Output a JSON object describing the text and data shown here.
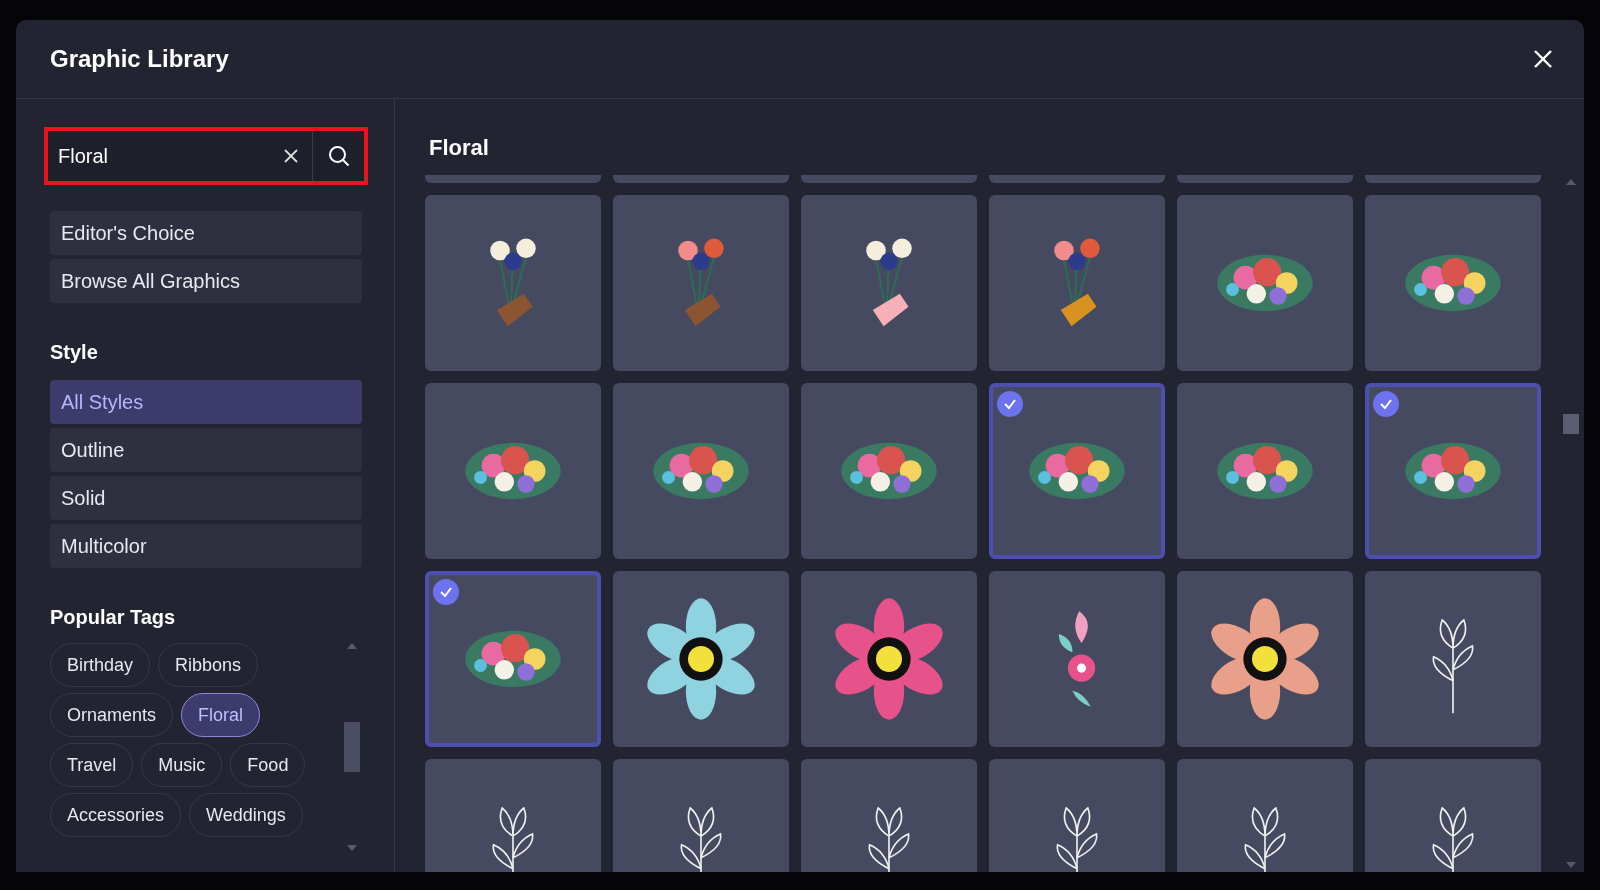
{
  "window": {
    "title": "Graphic Library"
  },
  "search": {
    "value": "Floral"
  },
  "collections": [
    {
      "label": "Editor's Choice"
    },
    {
      "label": "Browse All Graphics"
    }
  ],
  "style": {
    "heading": "Style",
    "options": [
      {
        "label": "All Styles",
        "selected": true
      },
      {
        "label": "Outline",
        "selected": false
      },
      {
        "label": "Solid",
        "selected": false
      },
      {
        "label": "Multicolor",
        "selected": false
      }
    ]
  },
  "tags": {
    "heading": "Popular Tags",
    "items": [
      {
        "label": "Birthday",
        "selected": false
      },
      {
        "label": "Ribbons",
        "selected": false
      },
      {
        "label": "Ornaments",
        "selected": false
      },
      {
        "label": "Floral",
        "selected": true
      },
      {
        "label": "Travel",
        "selected": false
      },
      {
        "label": "Music",
        "selected": false
      },
      {
        "label": "Food",
        "selected": false
      },
      {
        "label": "Accessories",
        "selected": false
      },
      {
        "label": "Weddings",
        "selected": false
      }
    ]
  },
  "gallery": {
    "title": "Floral",
    "tiles": [
      {
        "kind": "hand-bouquet",
        "selected": false
      },
      {
        "kind": "hand-bouquet",
        "selected": false
      },
      {
        "kind": "hand-bouquet",
        "selected": false
      },
      {
        "kind": "hand-bouquet",
        "selected": false
      },
      {
        "kind": "bouquet",
        "selected": false
      },
      {
        "kind": "bouquet",
        "selected": false
      },
      {
        "kind": "bouquet",
        "selected": false
      },
      {
        "kind": "bouquet",
        "selected": false
      },
      {
        "kind": "bouquet",
        "selected": false
      },
      {
        "kind": "bouquet",
        "selected": true
      },
      {
        "kind": "bouquet",
        "selected": false
      },
      {
        "kind": "bouquet",
        "selected": true
      },
      {
        "kind": "bouquet",
        "selected": true
      },
      {
        "kind": "bloom",
        "selected": false,
        "color": "#8fd3e0"
      },
      {
        "kind": "bloom",
        "selected": false,
        "color": "#e8528a"
      },
      {
        "kind": "sprig",
        "selected": false
      },
      {
        "kind": "bloom",
        "selected": false,
        "color": "#e8a08a"
      },
      {
        "kind": "line-flower",
        "selected": false
      },
      {
        "kind": "line-flower",
        "selected": false
      },
      {
        "kind": "line-flower",
        "selected": false
      },
      {
        "kind": "line-flower",
        "selected": false
      },
      {
        "kind": "line-flower",
        "selected": false
      },
      {
        "kind": "line-flower",
        "selected": false
      },
      {
        "kind": "line-flower",
        "selected": false
      }
    ]
  }
}
